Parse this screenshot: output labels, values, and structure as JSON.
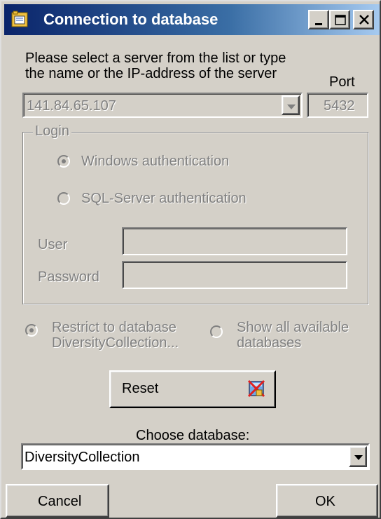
{
  "window": {
    "title": "Connection to database",
    "title_bar_gradient_start": "#0a246a",
    "title_bar_gradient_end": "#a6caf0",
    "controls": [
      "minimize-icon",
      "maximize-icon",
      "close-icon"
    ]
  },
  "server": {
    "instructions_line1": "Please select a server from the list or type",
    "instructions_line2": "the name or the IP-address of the server",
    "port_label": "Port",
    "server_value": "141.84.65.107",
    "port_value": "5432",
    "enabled": false
  },
  "login": {
    "group_label": "Login",
    "windows_auth_label": "Windows authentication",
    "windows_auth_selected": true,
    "sql_auth_label": "SQL-Server authentication",
    "sql_auth_selected": false,
    "user_label": "User",
    "user_value": "",
    "password_label": "Password",
    "password_value": "",
    "enabled": false
  },
  "scope": {
    "restrict_label_line1": "Restrict to database",
    "restrict_label_line2": "DiversityCollection...",
    "restrict_selected": true,
    "show_all_label_line1": "Show all available",
    "show_all_label_line2": "databases",
    "show_all_selected": false,
    "enabled": false
  },
  "reset": {
    "label": "Reset",
    "icon": "reset-database-icon"
  },
  "database": {
    "choose_label": "Choose database:",
    "selected_value": "DiversityCollection"
  },
  "footer": {
    "cancel_label": "Cancel",
    "ok_label": "OK"
  }
}
